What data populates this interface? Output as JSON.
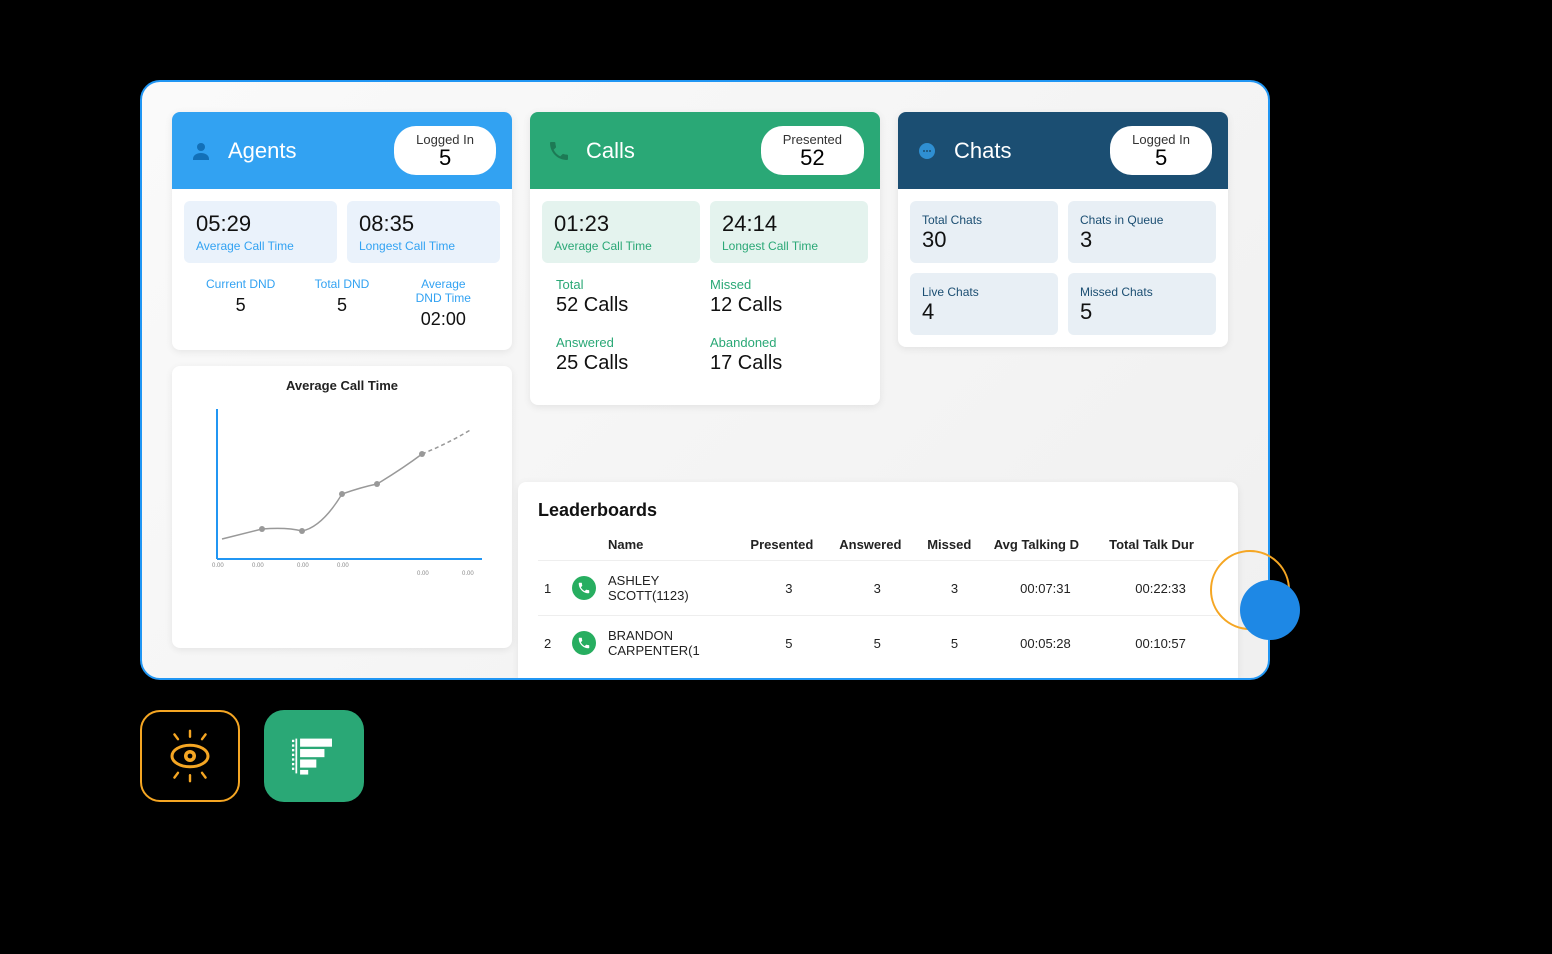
{
  "agents": {
    "title": "Agents",
    "pill_label": "Logged In",
    "pill_value": "5",
    "avg_call_time": {
      "label": "Average Call Time",
      "value": "05:29"
    },
    "longest_call_time": {
      "label": "Longest Call Time",
      "value": "08:35"
    },
    "current_dnd": {
      "label": "Current DND",
      "value": "5"
    },
    "total_dnd": {
      "label": "Total DND",
      "value": "5"
    },
    "avg_dnd_time": {
      "label": "Average\nDND Time",
      "value": "02:00"
    }
  },
  "calls": {
    "title": "Calls",
    "pill_label": "Presented",
    "pill_value": "52",
    "avg_call_time": {
      "label": "Average Call Time",
      "value": "01:23"
    },
    "longest_call_time": {
      "label": "Longest Call Time",
      "value": "24:14"
    },
    "total": {
      "label": "Total",
      "value": "52 Calls"
    },
    "missed": {
      "label": "Missed",
      "value": "12 Calls"
    },
    "answered": {
      "label": "Answered",
      "value": "25 Calls"
    },
    "abandoned": {
      "label": "Abandoned",
      "value": "17 Calls"
    }
  },
  "chats": {
    "title": "Chats",
    "pill_label": "Logged In",
    "pill_value": "5",
    "total_chats": {
      "label": "Total Chats",
      "value": "30"
    },
    "chats_in_queue": {
      "label": "Chats in Queue",
      "value": "3"
    },
    "live_chats": {
      "label": "Live Chats",
      "value": "4"
    },
    "missed_chats": {
      "label": "Missed Chats",
      "value": "5"
    }
  },
  "chart": {
    "title": "Average Call Time"
  },
  "leaderboard": {
    "title": "Leaderboards",
    "columns": [
      "Name",
      "Presented",
      "Answered",
      "Missed",
      "Avg Talking D",
      "Total Talk Dur"
    ],
    "rows": [
      {
        "rank": "1",
        "name": "ASHLEY SCOTT(1123)",
        "presented": "3",
        "answered": "3",
        "missed": "3",
        "avg": "00:07:31",
        "total": "00:22:33"
      },
      {
        "rank": "2",
        "name": "BRANDON CARPENTER(1",
        "presented": "5",
        "answered": "5",
        "missed": "5",
        "avg": "00:05:28",
        "total": "00:10:57"
      }
    ]
  },
  "chart_data": {
    "type": "line",
    "title": "Average Call Time",
    "xlabel": "",
    "ylabel": "",
    "x_ticks": [
      "0.00",
      "0.00",
      "0.00",
      "0.00",
      "0.00",
      "0.00"
    ],
    "series": [
      {
        "name": "avg_call_time",
        "values": [
          0.7,
          0.9,
          0.8,
          1.5,
          1.6,
          2.3,
          2.6
        ]
      }
    ],
    "ylim": [
      0,
      3
    ]
  }
}
